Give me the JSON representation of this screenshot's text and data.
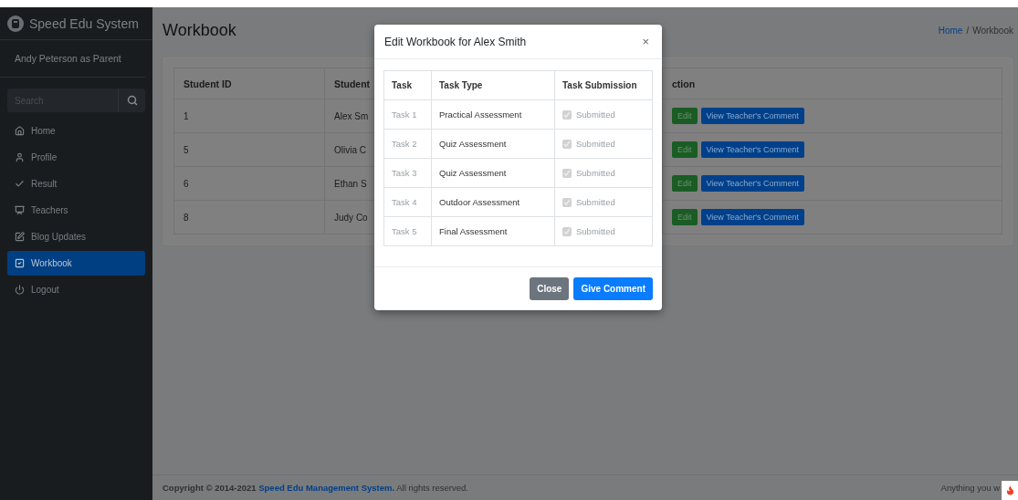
{
  "sidebar": {
    "brand": "Speed Edu System",
    "user": "Andy Peterson as Parent",
    "search": {
      "placeholder": "Search"
    },
    "items": [
      {
        "label": "Home",
        "selected": false
      },
      {
        "label": "Profile",
        "selected": false
      },
      {
        "label": "Result",
        "selected": false
      },
      {
        "label": "Teachers",
        "selected": false
      },
      {
        "label": "Blog Updates",
        "selected": false
      },
      {
        "label": "Workbook",
        "selected": true
      },
      {
        "label": "Logout",
        "selected": false
      }
    ]
  },
  "page": {
    "title": "Workbook",
    "breadcrumb_separator": "/",
    "breadcrumb": [
      {
        "label": "Home",
        "kind": "link"
      },
      {
        "label": "Workbook",
        "kind": "current"
      }
    ]
  },
  "table": {
    "columns": [
      "Student ID",
      "Student",
      "ction"
    ],
    "rows": [
      {
        "cells": [
          "1",
          "Alex Sm"
        ],
        "actions": [
          {
            "label": "Edit",
            "kind": "success"
          },
          {
            "label": "View Teacher's Comment",
            "kind": "primary"
          }
        ]
      },
      {
        "cells": [
          "5",
          "Olivia C"
        ],
        "actions": [
          {
            "label": "Edit",
            "kind": "success"
          },
          {
            "label": "View Teacher's Comment",
            "kind": "primary"
          }
        ]
      },
      {
        "cells": [
          "6",
          "Ethan S"
        ],
        "actions": [
          {
            "label": "Edit",
            "kind": "success"
          },
          {
            "label": "View Teacher's Comment",
            "kind": "primary"
          }
        ]
      },
      {
        "cells": [
          "8",
          "Judy Co"
        ],
        "actions": [
          {
            "label": "Edit",
            "kind": "success"
          },
          {
            "label": "View Teacher's Comment",
            "kind": "primary"
          }
        ]
      }
    ]
  },
  "modal": {
    "title": "Edit Workbook for Alex Smith",
    "close": "×",
    "columns": [
      "Task",
      "Task Type",
      "Task Submission"
    ],
    "rows": [
      {
        "task": "Task 1",
        "type": "Practical Assessment",
        "submitted": true,
        "label": "Submitted"
      },
      {
        "task": "Task 2",
        "type": "Quiz Assessment",
        "submitted": true,
        "label": "Submitted"
      },
      {
        "task": "Task 3",
        "type": "Quiz Assessment",
        "submitted": true,
        "label": "Submitted"
      },
      {
        "task": "Task 4",
        "type": "Outdoor Assessment",
        "submitted": true,
        "label": "Submitted"
      },
      {
        "task": "Task 5",
        "type": "Final Assessment",
        "submitted": true,
        "label": "Submitted"
      }
    ],
    "buttons": [
      {
        "label": "Close",
        "kind": "secondary"
      },
      {
        "label": "Give Comment",
        "kind": "primary"
      }
    ]
  },
  "footer": {
    "before": "Copyright © 2014-2021 ",
    "link": "Speed Edu Management System.",
    "after": " All rights reserved.",
    "right": "Anything you w"
  }
}
